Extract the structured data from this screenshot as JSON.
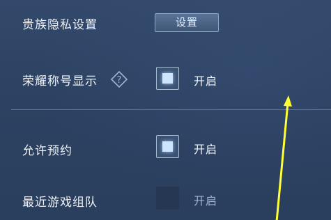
{
  "rows": {
    "noble_privacy": {
      "label": "贵族隐私设置",
      "button_label": "设置"
    },
    "honor_title": {
      "label": "荣耀称号显示",
      "toggle_label": "开启",
      "checked": true
    },
    "allow_reservation": {
      "label": "允许预约",
      "toggle_label": "开启",
      "checked": true
    },
    "recent_team": {
      "label": "最近游戏组队",
      "toggle_label": "开启",
      "checked": false
    }
  },
  "icons": {
    "help": "question-diamond-icon",
    "annotation_arrow": "yellow-arrow"
  },
  "colors": {
    "background": "#2d4262",
    "checkbox_mark": "#cfe4ff",
    "annotation": "#ffff33"
  }
}
